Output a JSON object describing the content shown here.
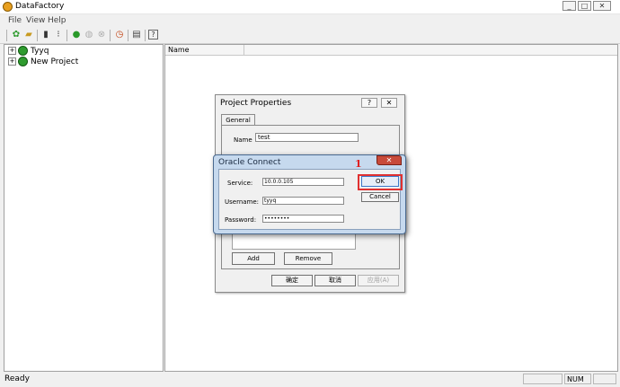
{
  "window": {
    "title": "DataFactory",
    "caption_minimize": "_",
    "caption_maximize": "□",
    "caption_close": "✕"
  },
  "menu": [
    "File",
    "View",
    "Help"
  ],
  "tree": {
    "items": [
      {
        "label": "Tyyq",
        "expander": "+"
      },
      {
        "label": "New Project",
        "expander": "+"
      }
    ]
  },
  "list": {
    "column_name": "Name"
  },
  "status": {
    "text": "Ready",
    "num": "NUM"
  },
  "project_dialog": {
    "title": "Project Properties",
    "help": "?",
    "close": "✕",
    "tab_general": "General",
    "name_label": "Name",
    "name_value": "test",
    "add_label": "Add",
    "remove_label": "Remove",
    "ok_label": "确定",
    "cancel_label": "取消",
    "apply_label": "应用(A)"
  },
  "oracle_dialog": {
    "title": "Oracle Connect",
    "close": "✕",
    "service_label": "Service:",
    "service_value": "10.0.0.105",
    "username_label": "Username:",
    "username_value": "tyyq",
    "password_label": "Password:",
    "password_value": "••••••••",
    "ok_label": "OK",
    "cancel_label": "Cancel"
  },
  "annotation": {
    "marker": "1",
    "color": "#e02020"
  },
  "colors": {
    "project_icon": "#2e9b2e",
    "close_red": "#c84a3a"
  }
}
